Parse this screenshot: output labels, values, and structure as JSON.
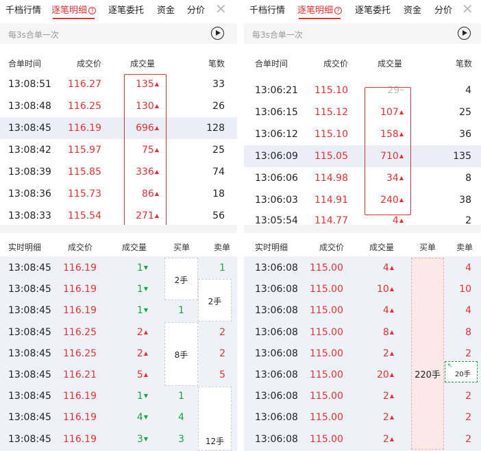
{
  "tabs": [
    "千档行情",
    "逐笔明细",
    "逐笔委托",
    "资金",
    "分价"
  ],
  "active_tab": 1,
  "help_icon": "?",
  "close_icon": "✕",
  "subtitle": "每3s合单一次",
  "colors": {
    "up": "#e93030",
    "down": "#18a33f",
    "highlight_row": "#ebeef7"
  },
  "left": {
    "upper_headers": [
      "合单时间",
      "成交价",
      "成交量",
      "笔数"
    ],
    "upper_rows": [
      {
        "time": "13:08:51",
        "price": "116.27",
        "vol": "135",
        "dir": "up",
        "count": "33",
        "hl": false
      },
      {
        "time": "13:08:48",
        "price": "116.25",
        "vol": "130",
        "dir": "up",
        "count": "26",
        "hl": false
      },
      {
        "time": "13:08:45",
        "price": "116.19",
        "vol": "696",
        "dir": "up",
        "count": "128",
        "hl": true
      },
      {
        "time": "13:08:42",
        "price": "115.97",
        "vol": "75",
        "dir": "up",
        "count": "25",
        "hl": false
      },
      {
        "time": "13:08:39",
        "price": "115.85",
        "vol": "336",
        "dir": "up",
        "count": "74",
        "hl": false
      },
      {
        "time": "13:08:36",
        "price": "115.73",
        "vol": "86",
        "dir": "up",
        "count": "18",
        "hl": false
      },
      {
        "time": "13:08:33",
        "price": "115.54",
        "vol": "271",
        "dir": "up",
        "count": "56",
        "hl": false
      }
    ],
    "lower_headers": [
      "实时明细",
      "成交价",
      "成交量",
      "买单",
      "卖单"
    ],
    "lower_rows": [
      {
        "time": "13:08:45",
        "price": "116.19",
        "pc": "r",
        "vol": "1",
        "dir": "down",
        "buy": "",
        "sell": "1",
        "sc": "g"
      },
      {
        "time": "13:08:45",
        "price": "116.19",
        "pc": "r",
        "vol": "1",
        "dir": "down",
        "buy": "",
        "sell": "",
        "sc": "g"
      },
      {
        "time": "13:08:45",
        "price": "116.19",
        "pc": "r",
        "vol": "1",
        "dir": "down",
        "buy": "1",
        "bc": "g",
        "sell": ""
      },
      {
        "time": "13:08:45",
        "price": "116.25",
        "pc": "r",
        "vol": "2",
        "dir": "up",
        "buy": "",
        "sell": "2",
        "sc": "r"
      },
      {
        "time": "13:08:45",
        "price": "116.25",
        "pc": "r",
        "vol": "2",
        "dir": "up",
        "buy": "",
        "sell": "2",
        "sc": "r"
      },
      {
        "time": "13:08:45",
        "price": "116.21",
        "pc": "r",
        "vol": "5",
        "dir": "up",
        "buy": "",
        "sell": "5",
        "sc": "r"
      },
      {
        "time": "13:08:45",
        "price": "116.19",
        "pc": "r",
        "vol": "1",
        "dir": "down",
        "buy": "1",
        "bc": "g",
        "sell": ""
      },
      {
        "time": "13:08:45",
        "price": "116.19",
        "pc": "r",
        "vol": "4",
        "dir": "down",
        "buy": "4",
        "bc": "g",
        "sell": ""
      },
      {
        "time": "13:08:45",
        "price": "116.19",
        "pc": "r",
        "vol": "3",
        "dir": "down",
        "buy": "3",
        "bc": "g",
        "sell": ""
      }
    ],
    "blocks": {
      "buy1": "2手",
      "sell1": "2手",
      "buy2": "8手",
      "sell2": "12手"
    }
  },
  "right": {
    "upper_headers": [
      "合单时间",
      "成交价",
      "成交量",
      "笔数"
    ],
    "upper_rows": [
      {
        "time": "13:06:21",
        "price": "115.10",
        "vol": "29",
        "dir": "flat",
        "count": "4",
        "hl": false
      },
      {
        "time": "13:06:15",
        "price": "115.12",
        "vol": "107",
        "dir": "up",
        "count": "25",
        "hl": false
      },
      {
        "time": "13:06:12",
        "price": "115.10",
        "vol": "158",
        "dir": "up",
        "count": "36",
        "hl": false
      },
      {
        "time": "13:06:09",
        "price": "115.05",
        "vol": "710",
        "dir": "up",
        "count": "135",
        "hl": true
      },
      {
        "time": "13:06:06",
        "price": "114.98",
        "vol": "34",
        "dir": "up",
        "count": "8",
        "hl": false
      },
      {
        "time": "13:06:03",
        "price": "114.91",
        "vol": "240",
        "dir": "up",
        "count": "38",
        "hl": false
      },
      {
        "time": "13:05:54",
        "price": "114.77",
        "vol": "4",
        "dir": "up",
        "count": "2",
        "hl": false
      }
    ],
    "lower_headers": [
      "实时明细",
      "成交价",
      "成交量",
      "买单",
      "卖单"
    ],
    "lower_rows": [
      {
        "time": "13:06:08",
        "price": "115.00",
        "vol": "4",
        "dir": "up",
        "sell": "4"
      },
      {
        "time": "13:06:08",
        "price": "115.00",
        "vol": "10",
        "dir": "up",
        "sell": "10"
      },
      {
        "time": "13:06:08",
        "price": "115.00",
        "vol": "4",
        "dir": "up",
        "sell": "4"
      },
      {
        "time": "13:06:08",
        "price": "115.00",
        "vol": "8",
        "dir": "up",
        "sell": "8"
      },
      {
        "time": "13:06:08",
        "price": "115.00",
        "vol": "2",
        "dir": "up",
        "sell": "2"
      },
      {
        "time": "13:06:08",
        "price": "115.00",
        "vol": "20",
        "dir": "up",
        "sell": ""
      },
      {
        "time": "13:06:08",
        "price": "115.00",
        "vol": "2",
        "dir": "up",
        "sell": "2"
      },
      {
        "time": "13:06:08",
        "price": "115.00",
        "vol": "2",
        "dir": "up",
        "sell": "2"
      },
      {
        "time": "13:06:08",
        "price": "115.00",
        "vol": "2",
        "dir": "up",
        "sell": "2"
      }
    ],
    "big_buy": "220手",
    "small_sell": "20手"
  }
}
